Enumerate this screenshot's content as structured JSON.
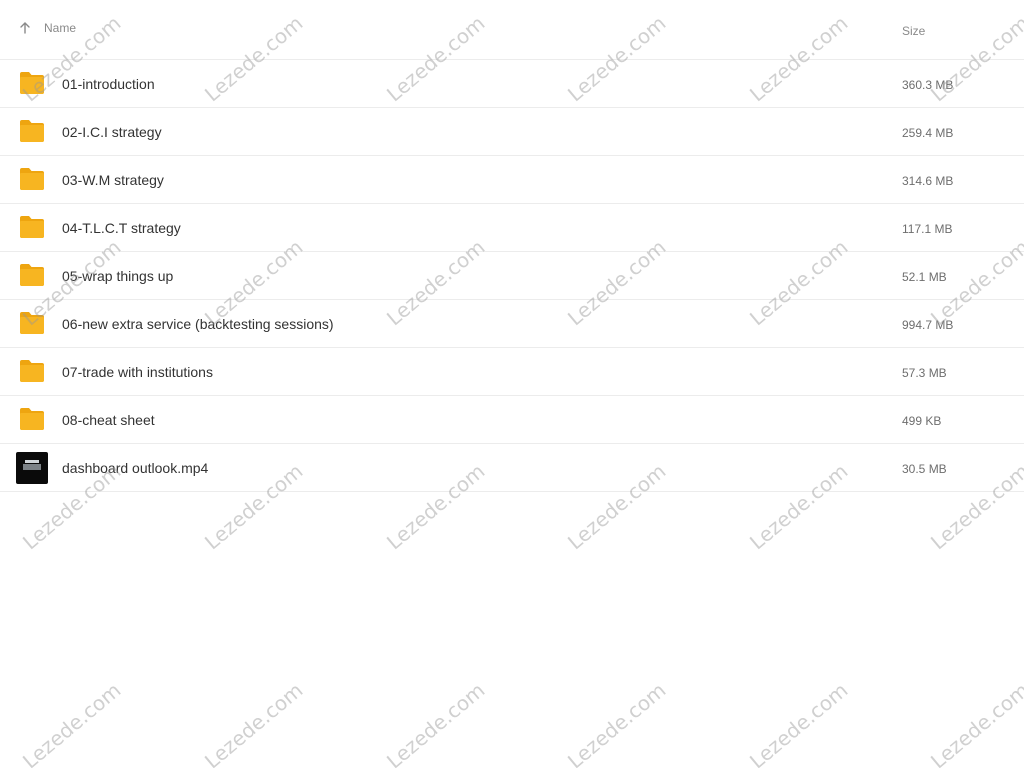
{
  "header": {
    "name_label": "Name",
    "size_label": "Size",
    "sort_icon": "arrow-up-icon"
  },
  "files": [
    {
      "type": "folder",
      "name": "01-introduction",
      "size": "360.3 MB"
    },
    {
      "type": "folder",
      "name": "02-I.C.I strategy",
      "size": "259.4 MB"
    },
    {
      "type": "folder",
      "name": "03-W.M strategy",
      "size": "314.6 MB"
    },
    {
      "type": "folder",
      "name": "04-T.L.C.T strategy",
      "size": "117.1 MB"
    },
    {
      "type": "folder",
      "name": "05-wrap things up",
      "size": "52.1 MB"
    },
    {
      "type": "folder",
      "name": "06-new extra service (backtesting sessions)",
      "size": "994.7 MB"
    },
    {
      "type": "folder",
      "name": "07-trade with institutions",
      "size": "57.3 MB"
    },
    {
      "type": "folder",
      "name": "08-cheat sheet",
      "size": "499 KB"
    },
    {
      "type": "video",
      "name": "dashboard outlook.mp4",
      "size": "30.5 MB"
    }
  ],
  "watermark": "Lezede.com",
  "colors": {
    "folder": "#f7b521",
    "folder_dark": "#eea510",
    "divider": "#ececec"
  }
}
